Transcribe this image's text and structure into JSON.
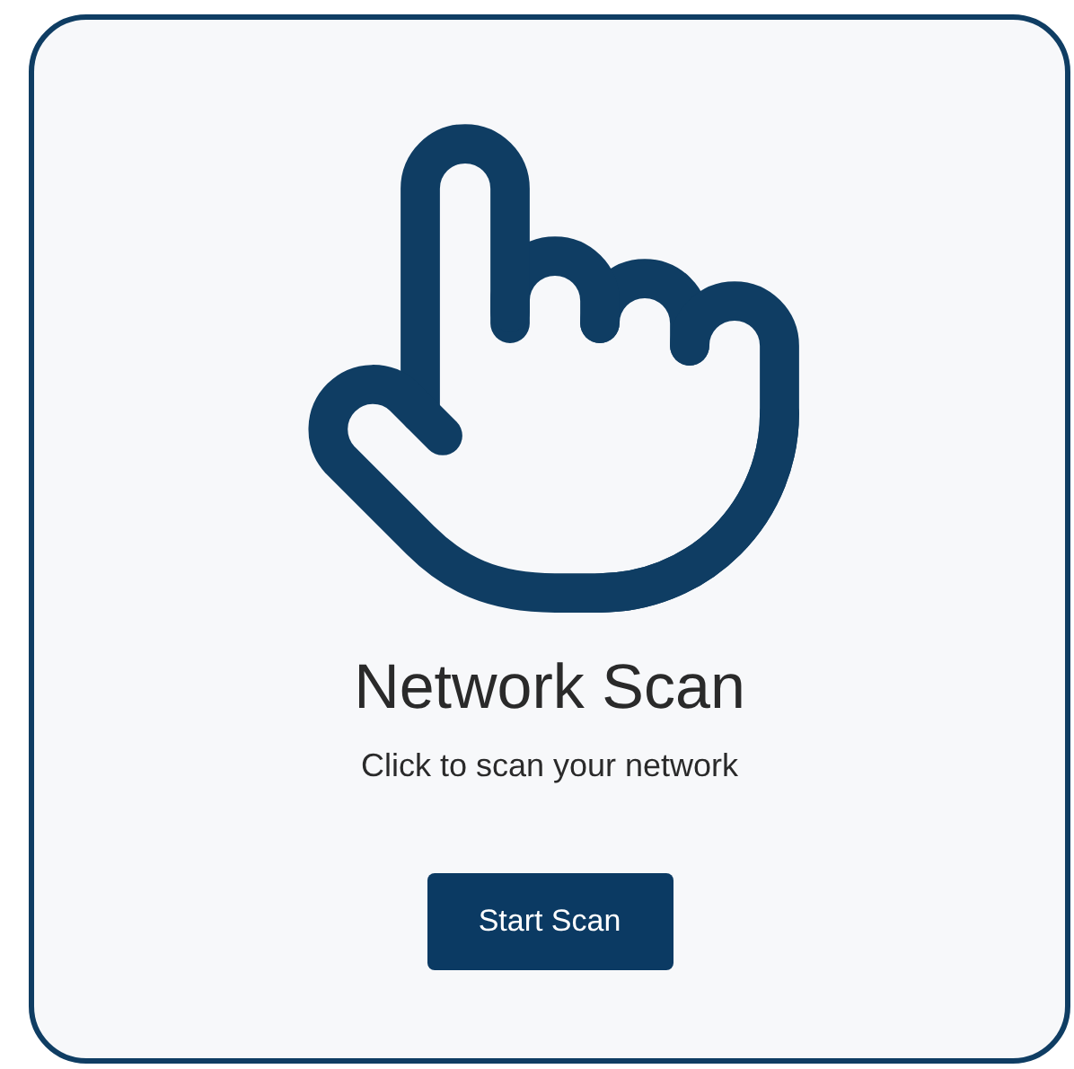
{
  "card": {
    "title": "Network Scan",
    "subtitle": "Click to scan your network",
    "button": "Start Scan"
  }
}
